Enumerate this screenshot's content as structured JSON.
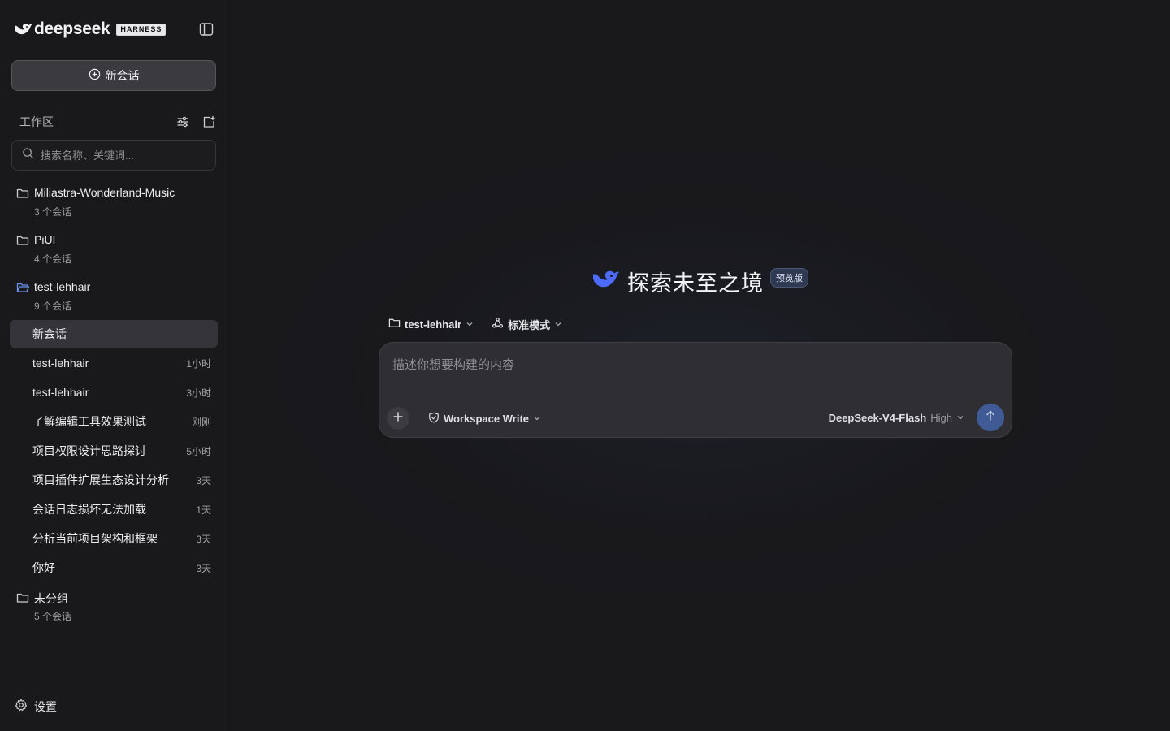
{
  "brand": {
    "name": "deepseek",
    "badge": "HARNESS",
    "logo_icon": "whale-logo-icon"
  },
  "sidebar": {
    "new_chat_label": "新会话",
    "workspace_title": "工作区",
    "search_placeholder": "搜索名称、关键词...",
    "folders": [
      {
        "name": "Miliastra-Wonderland-Music",
        "count": "3 个会话"
      },
      {
        "name": "PiUI",
        "count": "4 个会话"
      },
      {
        "name": "test-lehhair",
        "count": "9 个会话",
        "open": true
      },
      {
        "name": "未分组",
        "count": "5 个会话"
      }
    ],
    "conversations": [
      {
        "title": "新会话",
        "time": ""
      },
      {
        "title": "test-lehhair",
        "time": "1小时"
      },
      {
        "title": "test-lehhair",
        "time": "3小时"
      },
      {
        "title": "了解编辑工具效果测试",
        "time": "刚刚"
      },
      {
        "title": "项目权限设计思路探讨",
        "time": "5小时"
      },
      {
        "title": "项目插件扩展生态设计分析",
        "time": "3天"
      },
      {
        "title": "会话日志损坏无法加载",
        "time": "1天"
      },
      {
        "title": "分析当前项目架构和框架",
        "time": "3天"
      },
      {
        "title": "你好",
        "time": "3天"
      }
    ],
    "settings_label": "设置"
  },
  "main": {
    "hero_title": "探索未至之境",
    "hero_badge": "预览版",
    "workspace_selector": "test-lehhair",
    "mode_selector": "标准模式",
    "input_placeholder": "描述你想要构建的内容",
    "permission_selector": "Workspace Write",
    "model_name": "DeepSeek-V4-Flash",
    "model_level": "High"
  },
  "colors": {
    "accent": "#4d6bfe",
    "send_button": "#3f5a94",
    "active_item": "#34343a"
  }
}
